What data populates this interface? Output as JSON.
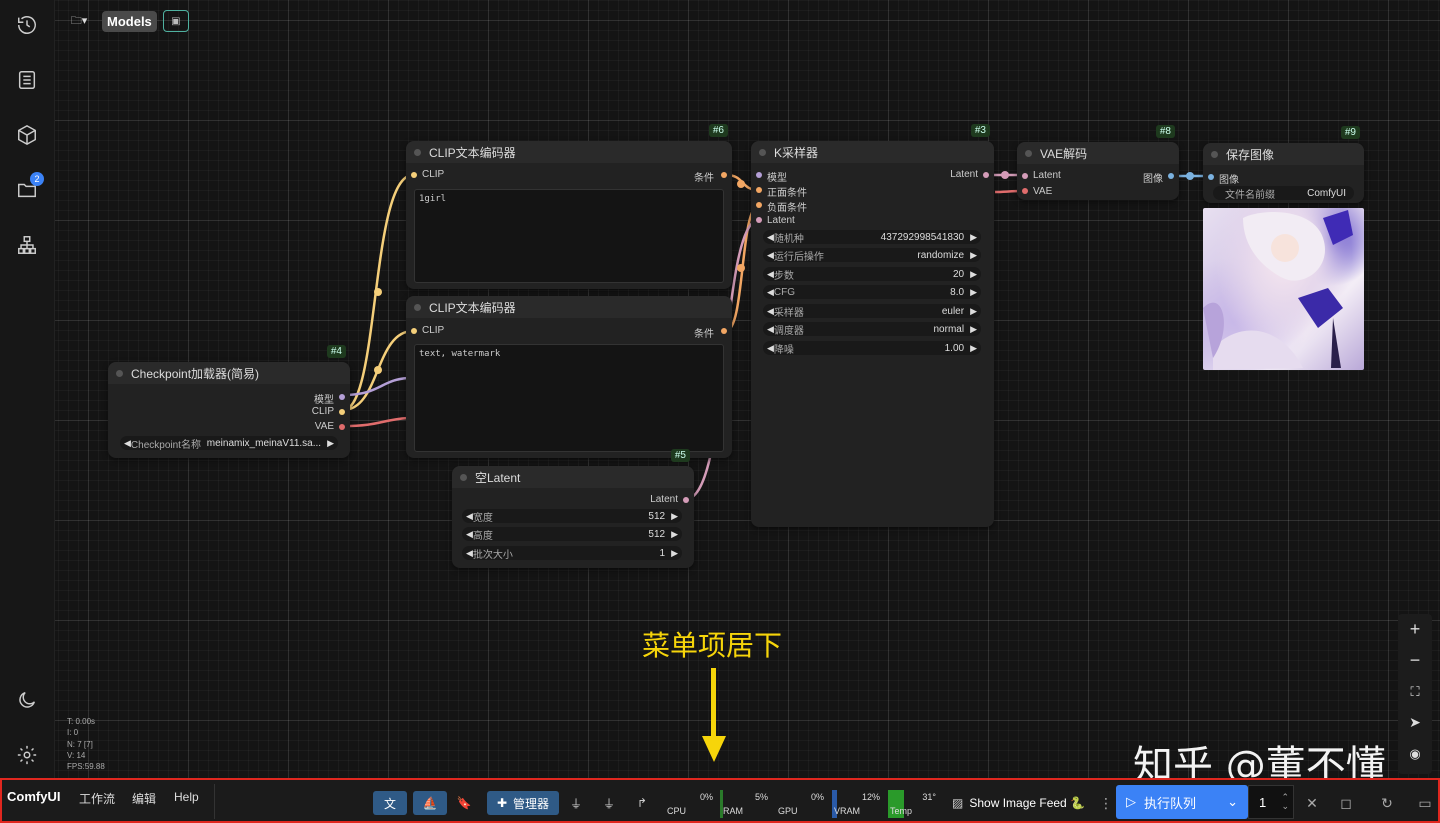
{
  "topbar": {
    "models_label": "Models"
  },
  "sidebar": {
    "queue_badge": "2"
  },
  "nodes": {
    "clip1": {
      "id": "#6",
      "title": "CLIP文本编码器",
      "in_clip": "CLIP",
      "out_cond": "条件",
      "text": "1girl"
    },
    "clip2": {
      "title": "CLIP文本编码器",
      "in_clip": "CLIP",
      "out_cond": "条件",
      "text": "text, watermark"
    },
    "ksampler": {
      "id": "#3",
      "title": "K采样器",
      "in_model": "模型",
      "in_pos": "正面条件",
      "in_neg": "负面条件",
      "in_latent": "Latent",
      "out_latent": "Latent",
      "widgets": [
        {
          "label": "随机种",
          "value": "437292998541830"
        },
        {
          "label": "运行后操作",
          "value": "randomize"
        },
        {
          "label": "步数",
          "value": "20"
        },
        {
          "label": "CFG",
          "value": "8.0"
        },
        {
          "label": "采样器",
          "value": "euler"
        },
        {
          "label": "调度器",
          "value": "normal"
        },
        {
          "label": "降噪",
          "value": "1.00"
        }
      ]
    },
    "vae": {
      "id": "#8",
      "title": "VAE解码",
      "in_latent": "Latent",
      "in_vae": "VAE",
      "out_image": "图像"
    },
    "save": {
      "id": "#9",
      "title": "保存图像",
      "in_image": "图像",
      "prefix_label": "文件名前缀",
      "prefix_value": "ComfyUI"
    },
    "checkpoint": {
      "id": "#4",
      "title": "Checkpoint加载器(简易)",
      "out_model": "模型",
      "out_clip": "CLIP",
      "out_vae": "VAE",
      "ckpt_label": "Checkpoint名称",
      "ckpt_value": "meinamix_meinaV11.sa..."
    },
    "latent": {
      "id": "#5",
      "title": "空Latent",
      "out_latent": "Latent",
      "widgets": [
        {
          "label": "宽度",
          "value": "512"
        },
        {
          "label": "高度",
          "value": "512"
        },
        {
          "label": "批次大小",
          "value": "1"
        }
      ]
    }
  },
  "stats": [
    "T: 0.00s",
    "I: 0",
    "N: 7 [7]",
    "V: 14",
    "FPS:59.88"
  ],
  "annotation": "菜单项居下",
  "watermark": "知乎 @董不懂",
  "menubar": {
    "brand": "ComfyUI",
    "workflow": "工作流",
    "edit": "编辑",
    "help": "Help",
    "manager": "管理器",
    "cpu_label": "CPU",
    "cpu_value": "0%",
    "ram_label": "RAM",
    "ram_value": "5%",
    "gpu_label": "GPU",
    "gpu_value": "0%",
    "vram_label": "VRAM",
    "vram_value": "12%",
    "temp_label": "Temp",
    "temp_value": "31°",
    "image_feed": "Show Image Feed 🐍",
    "run_label": "执行队列",
    "queue_count": "1"
  },
  "colors": {
    "accent": "#3b82f6",
    "highlight": "#e0271f",
    "annotation": "#f6d50a"
  }
}
